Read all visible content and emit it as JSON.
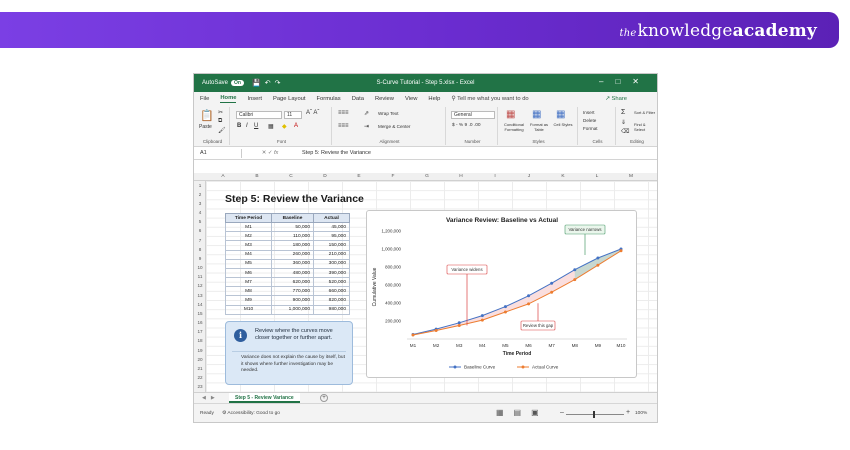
{
  "banner": {
    "brand_prefix": "the",
    "brand_main": "knowledge",
    "brand_bold": "academy",
    "bg_color": "#6a2ccf"
  },
  "window": {
    "autosave_label": "AutoSave",
    "autosave_state": "On",
    "title": "S-Curve Tutorial - Step 5.xlsx - Excel",
    "accent_color": "#217346"
  },
  "tabs": [
    "File",
    "Home",
    "Insert",
    "Page Layout",
    "Formulas",
    "Data",
    "Review",
    "View",
    "Help"
  ],
  "active_tab": "Home",
  "tell_me": "Tell me what you want to do",
  "share_label": "Share",
  "ribbon": {
    "clipboard": {
      "label": "Clipboard",
      "paste": "Paste"
    },
    "font": {
      "label": "Font",
      "font_name": "Calibri",
      "font_size": "11"
    },
    "alignment": {
      "label": "Alignment",
      "wrap": "Wrap Text",
      "merge": "Merge & Center"
    },
    "number": {
      "label": "Number",
      "format": "General",
      "symbols": "$ - % 9 .0 .00"
    },
    "styles": {
      "label": "Styles",
      "conditional": "Conditional Formatting",
      "format_table": "Format as Table",
      "cell_styles": "Cell Styles"
    },
    "cells": {
      "label": "Cells",
      "insert": "Insert",
      "delete": "Delete",
      "format": "Format"
    },
    "editing": {
      "label": "Editing",
      "sort": "Sort & Filter",
      "find": "Find & Select"
    }
  },
  "formula_bar": {
    "cell_ref": "A1",
    "fx": "fx",
    "content": "Step 5: Review the Variance"
  },
  "columns": [
    "A",
    "B",
    "C",
    "D",
    "E",
    "F",
    "G",
    "H",
    "I",
    "J",
    "K",
    "L",
    "M",
    "N"
  ],
  "rows": [
    "1",
    "2",
    "3",
    "4",
    "5",
    "6",
    "7",
    "8",
    "9",
    "10",
    "11",
    "12",
    "13",
    "14",
    "15",
    "16",
    "17",
    "18",
    "19",
    "20",
    "21",
    "22",
    "23"
  ],
  "sheet": {
    "title": "Step 5: Review the Variance",
    "table": {
      "headers": [
        "Time Period",
        "Baseline",
        "Actual"
      ],
      "rows": [
        [
          "M1",
          "50,000",
          "45,000"
        ],
        [
          "M2",
          "110,000",
          "95,000"
        ],
        [
          "M3",
          "180,000",
          "150,000"
        ],
        [
          "M4",
          "260,000",
          "210,000"
        ],
        [
          "M5",
          "360,000",
          "300,000"
        ],
        [
          "M6",
          "480,000",
          "390,000"
        ],
        [
          "M7",
          "620,000",
          "520,000"
        ],
        [
          "M8",
          "770,000",
          "660,000"
        ],
        [
          "M9",
          "900,000",
          "820,000"
        ],
        [
          "M10",
          "1,000,000",
          "980,000"
        ]
      ]
    },
    "callout": {
      "message": "Review where the curves move closer together or further apart.",
      "note": "Variance does not explain the cause by itself, but it shows where further investigation may be needed."
    }
  },
  "chart_data": {
    "type": "line",
    "title": "Variance Review: Baseline vs Actual",
    "xlabel": "Time Period",
    "ylabel": "Cumulative Value",
    "categories": [
      "M1",
      "M2",
      "M3",
      "M4",
      "M5",
      "M6",
      "M7",
      "M8",
      "M9",
      "M10"
    ],
    "series": [
      {
        "name": "Baseline Curve",
        "values": [
          50000,
          110000,
          180000,
          260000,
          360000,
          480000,
          620000,
          770000,
          900000,
          1000000
        ],
        "color": "#4472c4"
      },
      {
        "name": "Actual Curve",
        "values": [
          45000,
          95000,
          150000,
          210000,
          300000,
          390000,
          520000,
          660000,
          820000,
          980000
        ],
        "color": "#ed7d31"
      }
    ],
    "yticks": [
      "200,000",
      "400,000",
      "600,000",
      "800,000",
      "1,000,000",
      "1,200,000"
    ],
    "ylim": [
      0,
      1200000
    ],
    "grid": false,
    "legend": "bottom",
    "annotations": [
      "Variance widens",
      "Review this gap",
      "Variance narrows"
    ]
  },
  "sheet_tab": "Step 5 - Review Variance",
  "status": {
    "ready": "Ready",
    "accessibility": "Accessibility: Good to go",
    "zoom": "100%"
  }
}
